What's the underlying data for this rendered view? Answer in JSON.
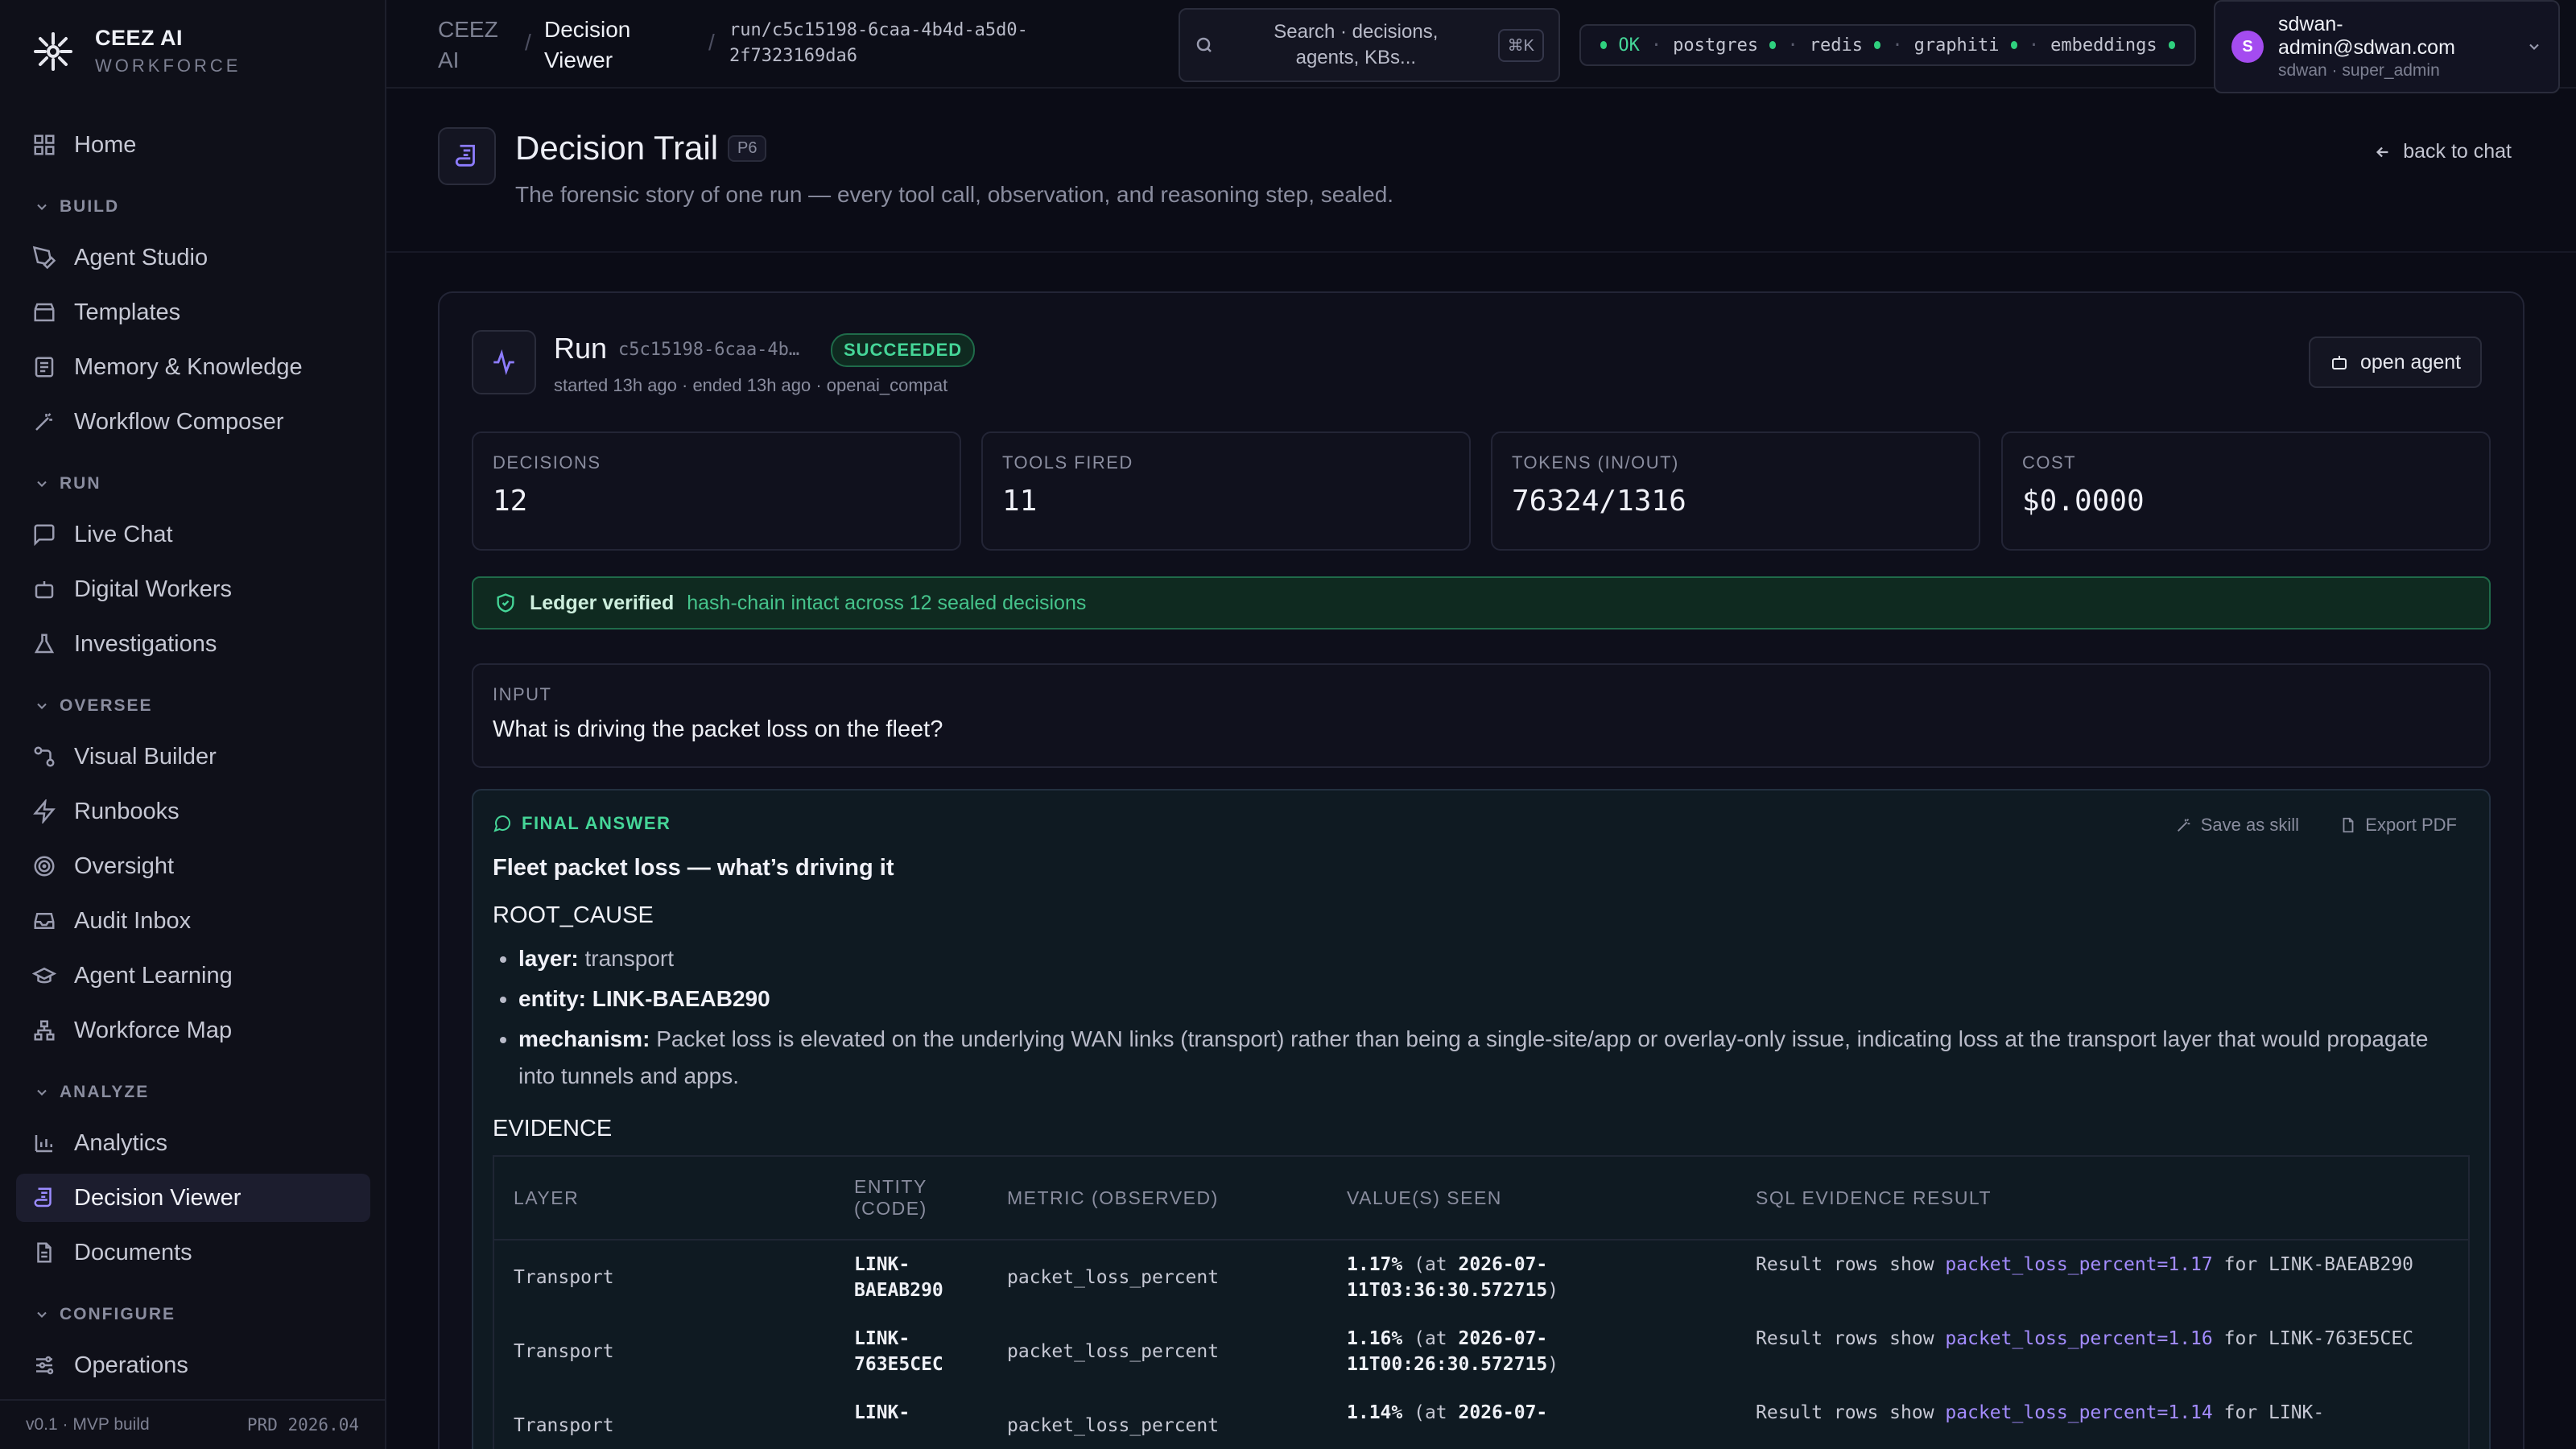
{
  "brand": {
    "title": "CEEZ AI",
    "subtitle": "WORKFORCE"
  },
  "sidebar": {
    "home": "Home",
    "groups": [
      {
        "label": "BUILD",
        "items": [
          "Agent Studio",
          "Templates",
          "Memory & Knowledge",
          "Workflow Composer"
        ]
      },
      {
        "label": "RUN",
        "items": [
          "Live Chat",
          "Digital Workers",
          "Investigations"
        ]
      },
      {
        "label": "OVERSEE",
        "items": [
          "Visual Builder",
          "Runbooks",
          "Oversight",
          "Audit Inbox",
          "Agent Learning",
          "Workforce Map"
        ]
      },
      {
        "label": "ANALYZE",
        "items": [
          "Analytics",
          "Decision Viewer",
          "Documents"
        ]
      },
      {
        "label": "CONFIGURE",
        "items": [
          "Operations"
        ]
      }
    ],
    "footer_version": "v0.1 · MVP build",
    "footer_build": "PRD 2026.04"
  },
  "topbar": {
    "crumb_root_1": "CEEZ",
    "crumb_root_2": "AI",
    "crumb_page_1": "Decision",
    "crumb_page_2": "Viewer",
    "crumb_path_1": "run/c5c15198-6caa-4b4d-a5d0-",
    "crumb_path_2": "2f7323169da6",
    "search_1": "Search · decisions,",
    "search_2": "agents, KBs...",
    "search_kbd": "⌘K",
    "health": {
      "status": "OK",
      "services": [
        "postgres",
        "redis",
        "graphiti",
        "embeddings"
      ]
    },
    "user": {
      "initial": "S",
      "email_1": "sdwan-",
      "email_2": "admin@sdwan.com",
      "meta": "sdwan · super_admin"
    }
  },
  "header": {
    "title": "Decision Trail",
    "tag": "P6",
    "subtitle": "The forensic story of one run — every tool call, observation, and reasoning step, sealed.",
    "back": "back to chat"
  },
  "run": {
    "label": "Run",
    "id": "c5c15198-6caa-4b…",
    "status": "SUCCEEDED",
    "meta": "started 13h ago · ended 13h ago · openai_compat",
    "open_agent": "open agent"
  },
  "stats": [
    {
      "label": "DECISIONS",
      "value": "12"
    },
    {
      "label": "TOOLS FIRED",
      "value": "11"
    },
    {
      "label": "TOKENS (IN/OUT)",
      "value": "76324/1316"
    },
    {
      "label": "COST",
      "value": "$0.0000"
    }
  ],
  "ledger": {
    "title": "Ledger verified",
    "text": "hash-chain intact across 12 sealed decisions"
  },
  "input": {
    "label": "INPUT",
    "text": "What is driving the packet loss on the fleet?"
  },
  "final": {
    "label": "FINAL ANSWER",
    "save_skill": "Save as skill",
    "export_pdf": "Export PDF",
    "title": "Fleet packet loss — what’s driving it",
    "root_cause_heading": "ROOT_CAUSE",
    "root_cause": [
      {
        "key": "layer:",
        "value": "transport"
      },
      {
        "key": "entity: LINK-BAEAB290",
        "value": ""
      },
      {
        "key": "mechanism:",
        "value": "Packet loss is elevated on the underlying WAN links (transport) rather than being a single-site/app or overlay-only issue, indicating loss at the transport layer that would propagate into tunnels and apps."
      }
    ],
    "evidence_heading": "EVIDENCE",
    "columns": [
      "LAYER",
      "ENTITY (CODE)",
      "METRIC (OBSERVED)",
      "VALUE(S) SEEN",
      "SQL EVIDENCE RESULT"
    ],
    "rows": [
      {
        "layer": "Transport",
        "entity": "LINK-BAEAB290",
        "metric": "packet_loss_percent",
        "value": "1.17%",
        "at": "2026-07-11T03:36:30.572715",
        "res_pre": "Result rows show",
        "res_hl": "packet_loss_percent=1.17",
        "res_post": "for LINK-BAEAB290"
      },
      {
        "layer": "Transport",
        "entity": "LINK-763E5CEC",
        "metric": "packet_loss_percent",
        "value": "1.16%",
        "at": "2026-07-11T00:26:30.572715",
        "res_pre": "Result rows show",
        "res_hl": "packet_loss_percent=1.16",
        "res_post": "for LINK-763E5CEC"
      },
      {
        "layer": "Transport",
        "entity": "LINK-",
        "metric": "packet_loss_percent",
        "value": "1.14%",
        "at": "2026-07-",
        "res_pre": "Result rows show",
        "res_hl": "packet_loss_percent=1.14",
        "res_post": "for LINK-"
      }
    ]
  }
}
